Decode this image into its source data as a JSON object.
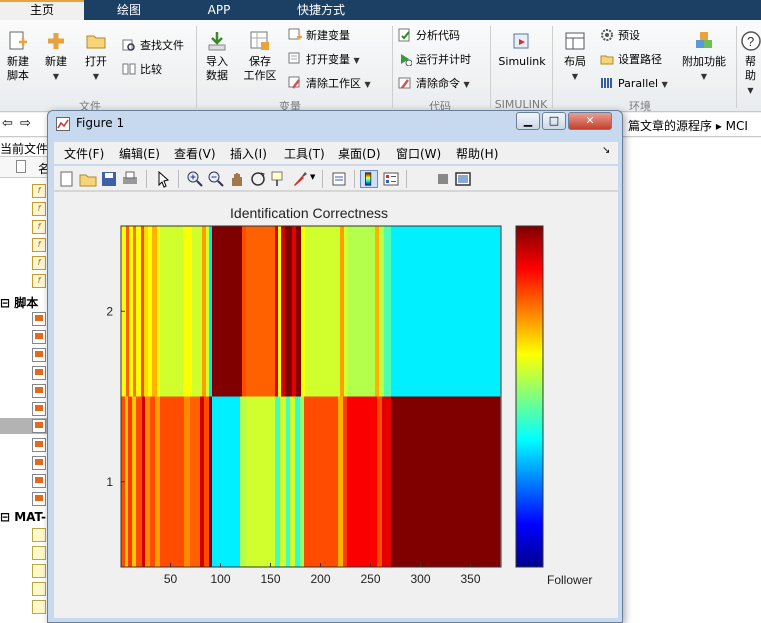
{
  "ribbon": {
    "tabs": [
      "主页",
      "绘图",
      "APP",
      "快捷方式"
    ],
    "buttons": {
      "new_script": "新建\n脚本",
      "new": "新建",
      "open": "打开",
      "find_files": "查找文件",
      "compare": "比较",
      "import_data": "导入\n数据",
      "save_workspace": "保存\n工作区",
      "new_variable": "新建变量",
      "open_variable": "打开变量",
      "clear_workspace": "清除工作区",
      "analyze_code": "分析代码",
      "run_and_time": "运行并计时",
      "clear_commands": "清除命令",
      "simulink": "Simulink",
      "layout": "布局",
      "preferences": "预设",
      "set_path": "设置路径",
      "parallel": "Parallel",
      "addons": "附加功能",
      "help": "帮助"
    },
    "groups": [
      "文件",
      "变量",
      "代码",
      "SIMULINK",
      "环境"
    ]
  },
  "address": {
    "tail": "篇文章的源程序 ▸ MCI"
  },
  "file_panel": {
    "current_folder_label": "当前文件",
    "name_header": "名",
    "scripts_section": "脚本",
    "mat_section": "MAT-"
  },
  "figure": {
    "title": "Figure 1",
    "menus": [
      "文件(F)",
      "编辑(E)",
      "查看(V)",
      "插入(I)",
      "工具(T)",
      "桌面(D)",
      "窗口(W)",
      "帮助(H)"
    ],
    "menu_overflow": "↘",
    "controls": {
      "minimize": "▁",
      "maximize": "□",
      "close": "✕"
    }
  },
  "chart_data": {
    "type": "heatmap",
    "title": "Identification Correctness",
    "x_ticks": [
      50,
      100,
      150,
      200,
      250,
      300,
      350
    ],
    "y_ticks": [
      1,
      2
    ],
    "xlim": [
      0.5,
      380.5
    ],
    "ylim": [
      0.5,
      2.5
    ],
    "colormap": "jet",
    "colorbar_label": "Follower",
    "clim": [
      0,
      1
    ],
    "rows": [
      {
        "y": 2,
        "bands": [
          [
            1,
            6,
            0.62
          ],
          [
            6,
            9,
            0.78
          ],
          [
            9,
            13,
            0.62
          ],
          [
            13,
            16,
            0.76
          ],
          [
            16,
            21,
            0.62
          ],
          [
            21,
            24,
            0.8
          ],
          [
            24,
            28,
            0.66
          ],
          [
            28,
            32,
            0.62
          ],
          [
            32,
            37,
            0.7
          ],
          [
            37,
            40,
            0.62
          ],
          [
            40,
            63,
            0.58
          ],
          [
            63,
            72,
            0.62
          ],
          [
            72,
            82,
            0.58
          ],
          [
            82,
            86,
            0.72
          ],
          [
            86,
            89,
            0.58
          ],
          [
            89,
            92,
            0.35
          ],
          [
            92,
            122,
            1.0
          ],
          [
            122,
            126,
            0.8
          ],
          [
            126,
            155,
            0.78
          ],
          [
            155,
            158,
            0.9
          ],
          [
            158,
            161,
            0.62
          ],
          [
            161,
            165,
            0.92
          ],
          [
            165,
            172,
            1.0
          ],
          [
            172,
            176,
            0.9
          ],
          [
            176,
            181,
            1.0
          ],
          [
            181,
            185,
            0.62
          ],
          [
            185,
            220,
            0.58
          ],
          [
            220,
            224,
            0.72
          ],
          [
            224,
            228,
            0.58
          ],
          [
            228,
            255,
            0.55
          ],
          [
            255,
            259,
            0.7
          ],
          [
            259,
            264,
            0.55
          ],
          [
            264,
            271,
            0.45
          ],
          [
            271,
            380,
            0.36
          ]
        ]
      },
      {
        "y": 1,
        "bands": [
          [
            1,
            5,
            0.8
          ],
          [
            5,
            8,
            0.68
          ],
          [
            8,
            12,
            0.82
          ],
          [
            12,
            16,
            0.68
          ],
          [
            16,
            22,
            0.8
          ],
          [
            22,
            25,
            0.92
          ],
          [
            25,
            30,
            0.74
          ],
          [
            30,
            35,
            0.8
          ],
          [
            35,
            40,
            0.72
          ],
          [
            40,
            64,
            0.8
          ],
          [
            64,
            70,
            0.74
          ],
          [
            70,
            80,
            0.78
          ],
          [
            80,
            84,
            0.92
          ],
          [
            84,
            89,
            0.8
          ],
          [
            89,
            92,
            1.0
          ],
          [
            92,
            120,
            0.36
          ],
          [
            120,
            126,
            0.55
          ],
          [
            126,
            155,
            0.58
          ],
          [
            155,
            160,
            0.44
          ],
          [
            160,
            166,
            0.58
          ],
          [
            166,
            170,
            0.44
          ],
          [
            170,
            175,
            0.58
          ],
          [
            175,
            180,
            0.42
          ],
          [
            180,
            184,
            0.52
          ],
          [
            184,
            218,
            0.8
          ],
          [
            218,
            223,
            0.7
          ],
          [
            223,
            227,
            0.82
          ],
          [
            227,
            257,
            0.88
          ],
          [
            257,
            262,
            0.8
          ],
          [
            262,
            271,
            0.9
          ],
          [
            271,
            380,
            1.0
          ]
        ]
      }
    ]
  },
  "colors": {
    "tab_bar": "#1c3f64",
    "accent": "#e8a33d",
    "window_frame": "#c6d9ef"
  }
}
